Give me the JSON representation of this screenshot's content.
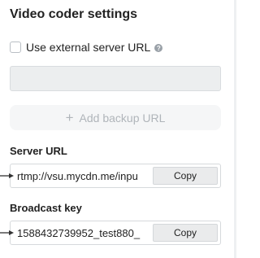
{
  "title": "Video coder settings",
  "external_server": {
    "checkbox_label": "Use external server URL",
    "help_icon": "?",
    "checked": false
  },
  "backup": {
    "plus_icon": "+",
    "label": "Add backup URL"
  },
  "server_url": {
    "label": "Server URL",
    "value": "rtmp://vsu.mycdn.me/inpu",
    "copy_label": "Copy"
  },
  "broadcast_key": {
    "label": "Broadcast key",
    "value": "1588432739952_test880_",
    "copy_label": "Copy"
  },
  "icons": {
    "help": "question-circle-icon",
    "plus": "plus-icon",
    "pointer": "arrow-right-icon"
  },
  "colors": {
    "disabled_bg": "#eceeef",
    "button_bg": "#eaebec",
    "muted_text": "#b0b5ba"
  }
}
